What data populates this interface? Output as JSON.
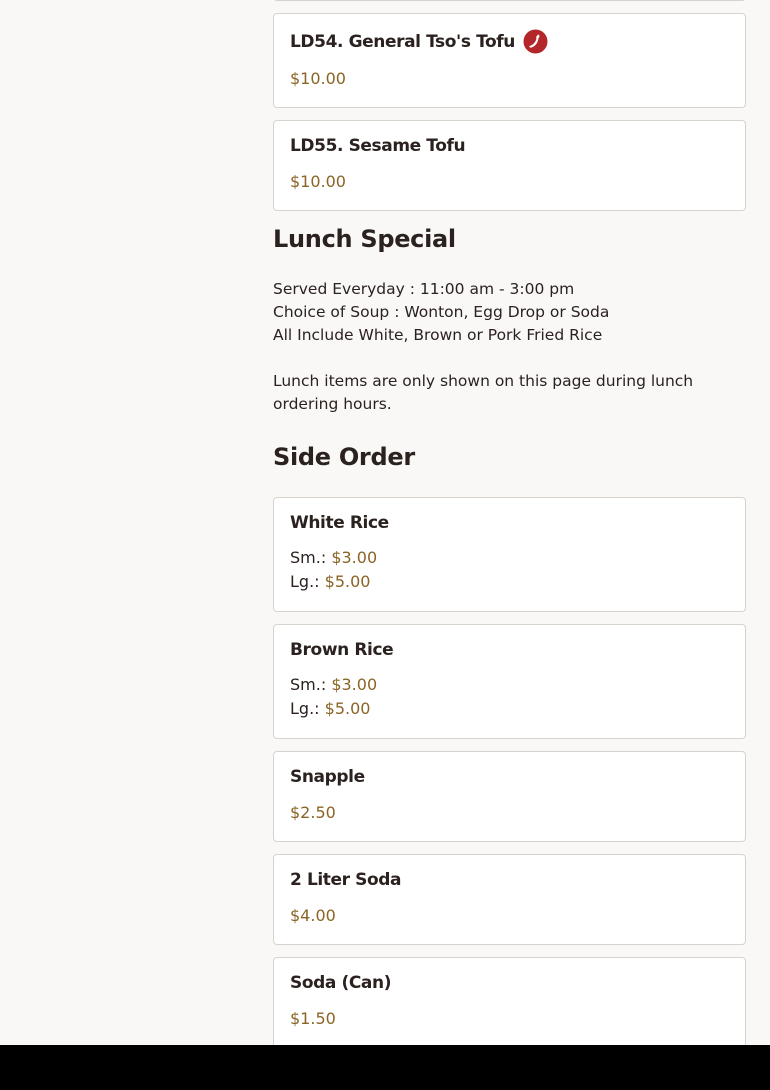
{
  "items_top": [
    {
      "name": "LD54. General Tso's Tofu",
      "price": "$10.00",
      "spicy": true
    },
    {
      "name": "LD55. Sesame Tofu",
      "price": "$10.00"
    }
  ],
  "lunch_special": {
    "title": "Lunch Special",
    "lines": [
      "Served Everyday : 11:00 am - 3:00 pm",
      "Choice of Soup : Wonton, Egg Drop or Soda",
      "All Include White, Brown or Pork Fried Rice"
    ],
    "notice": "Lunch items are only shown on this page during lunch ordering hours."
  },
  "side_order": {
    "title": "Side Order",
    "items": [
      {
        "name": "White Rice",
        "sizes": [
          {
            "label": "Sm.:",
            "price": "$3.00"
          },
          {
            "label": "Lg.:",
            "price": "$5.00"
          }
        ]
      },
      {
        "name": "Brown Rice",
        "sizes": [
          {
            "label": "Sm.:",
            "price": "$3.00"
          },
          {
            "label": "Lg.:",
            "price": "$5.00"
          }
        ]
      },
      {
        "name": "Snapple",
        "price": "$2.50"
      },
      {
        "name": "2 Liter Soda",
        "price": "$4.00"
      },
      {
        "name": "Soda (Can)",
        "price": "$1.50"
      }
    ]
  },
  "colors": {
    "price": "#8a6424",
    "spicy_icon": "#b3262a",
    "card_border": "#d7d2cc",
    "background": "#f9f8f6"
  }
}
